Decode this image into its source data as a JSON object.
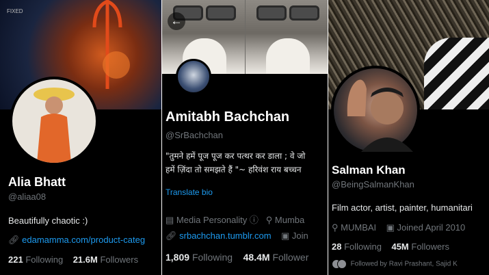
{
  "profiles": [
    {
      "banner_tag": "FIXED",
      "name": "Alia Bhatt",
      "handle": "@aliaa08",
      "bio": "Beautifully chaotic :)",
      "link": "edamamma.com/product-categ",
      "following_count": "221",
      "following_label": "Following",
      "followers_count": "21.6M",
      "followers_label": "Followers"
    },
    {
      "name": "Amitabh Bachchan",
      "handle": "@SrBachchan",
      "bio_line1": "\"तुमने हमें पूज पूज कर पत्थर कर डाला ; वे जो",
      "bio_line2": "हमें ज़िंदा तो समझते हैं \"~  हरिवंश राय  बच्चन",
      "translate_label": "Translate bio",
      "category": "Media Personality",
      "location": "Mumba",
      "link": "srbachchan.tumblr.com",
      "joined": "Join",
      "following_count": "1,809",
      "following_label": "Following",
      "followers_count": "48.4M",
      "followers_label": "Follower"
    },
    {
      "name": "Salman Khan",
      "handle": "@BeingSalmanKhan",
      "bio": "Film actor, artist, painter, humanitari",
      "location": "MUMBAI",
      "joined": "Joined April 2010",
      "following_count": "28",
      "following_label": "Following",
      "followers_count": "45M",
      "followers_label": "Followers",
      "followed_by": "Followed by Ravi Prashant, Sajid K"
    }
  ],
  "colors": {
    "link": "#1d9bf0",
    "muted": "#71767b",
    "text": "#e7e9ea",
    "background": "#000000"
  },
  "icons": [
    "link-icon",
    "briefcase-icon",
    "info-icon",
    "location-icon",
    "calendar-icon",
    "back-arrow-icon"
  ]
}
